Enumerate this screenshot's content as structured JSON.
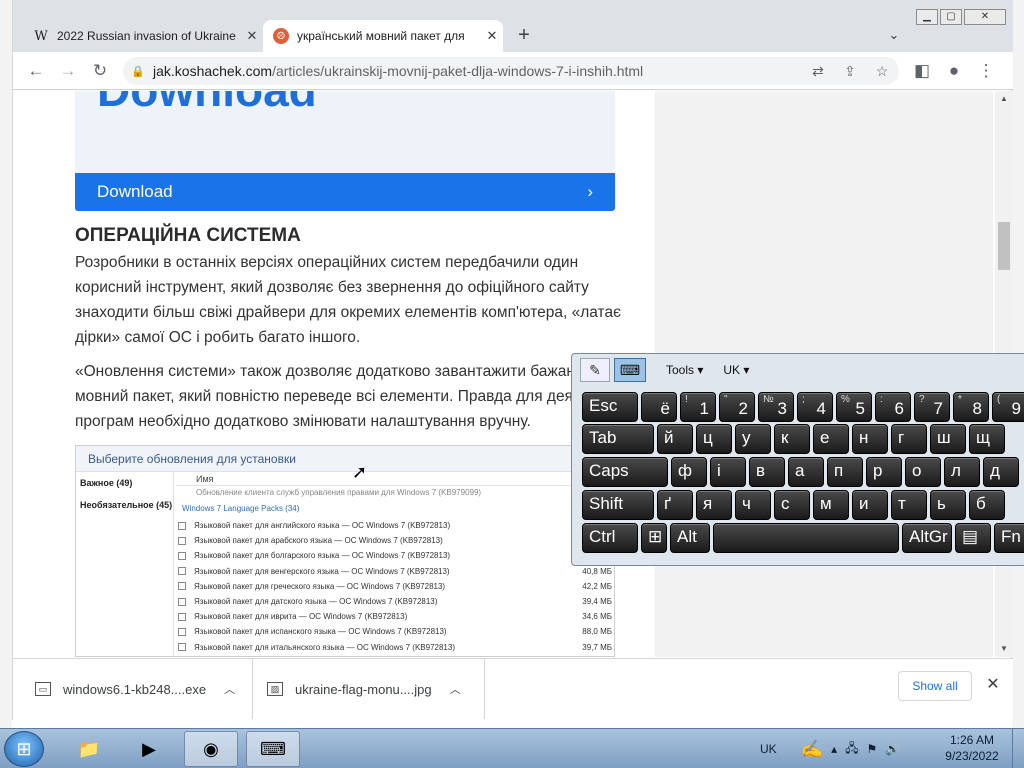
{
  "browser": {
    "tabs": [
      {
        "title": "2022 Russian invasion of Ukraine",
        "favicon": "W"
      },
      {
        "title": "український мовний пакет для",
        "favicon": "face-icon"
      }
    ],
    "new_tab": "+",
    "url_host": "jak.koshachek.com",
    "url_path": "/articles/ukrainskij-movnij-paket-dlja-windows-7-i-inshih.html"
  },
  "article": {
    "download_big": "Download",
    "download_button": "Download",
    "heading": "ОПЕРАЦІЙНА СИСТЕМА",
    "para1": "Розробники в останніх версіях операційних систем передбачили один корисний інструмент, який дозволяє без звернення до офіційного сайту знаходити більш свіжі драйвери для окремих елементів комп'ютера, «латає дірки» самої ОС і робить багато іншого.",
    "para2": "«Оновлення системи» також дозволяє додатково завантажити бажаний мовний пакет, який повністю переведе всі елементи. Правда для деяких програм необхідно додатково змінювати налаштування вручну.",
    "screenshot": {
      "header": "Выберите обновления для установки",
      "left": [
        "Важное (49)",
        "Необязательное (45)"
      ],
      "col_name": "Имя",
      "sub": "Обновление клиента служб управления правами для Windows 7 (KB979099)",
      "group": "Windows 7 Language Packs (34)",
      "rows": [
        {
          "name": "Языковой пакет для английского языка — ОС Windows 7 (KB972813)",
          "size": ""
        },
        {
          "name": "Языковой пакет для арабского языка — ОС Windows 7 (KB972813)",
          "size": ""
        },
        {
          "name": "Языковой пакет для болгарского языка — ОС Windows 7 (KB972813)",
          "size": ""
        },
        {
          "name": "Языковой пакет для венгерского языка — ОС Windows 7 (KB972813)",
          "size": "40,8 МБ"
        },
        {
          "name": "Языковой пакет для греческого языка — ОС Windows 7 (KB972813)",
          "size": "42,2 МБ"
        },
        {
          "name": "Языковой пакет для датского языка — ОС Windows 7 (KB972813)",
          "size": "39,4 МБ"
        },
        {
          "name": "Языковой пакет для иврита — ОС Windows 7 (KB972813)",
          "size": "34,6 МБ"
        },
        {
          "name": "Языковой пакет для испанского языка — ОС Windows 7 (KB972813)",
          "size": "88,0 МБ"
        },
        {
          "name": "Языковой пакет для итальянского языка — ОС Windows 7 (KB972813)",
          "size": "39,7 МБ"
        }
      ]
    }
  },
  "downloads": {
    "items": [
      "windows6.1-kb248....exe",
      "ukraine-flag-monu....jpg"
    ],
    "show_all": "Show all"
  },
  "osk": {
    "tools": "Tools",
    "lang": "UK",
    "row1": [
      {
        "main": "Esc"
      },
      {
        "top": "",
        "bottom": "ё"
      },
      {
        "top": "!",
        "bottom": "1"
      },
      {
        "top": "\"",
        "bottom": "2"
      },
      {
        "top": "№",
        "bottom": "3"
      },
      {
        "top": ";",
        "bottom": "4"
      },
      {
        "top": "%",
        "bottom": "5"
      },
      {
        "top": ":",
        "bottom": "6"
      },
      {
        "top": "?",
        "bottom": "7"
      },
      {
        "top": "*",
        "bottom": "8"
      },
      {
        "top": "(",
        "bottom": "9"
      }
    ],
    "row2": [
      "Tab",
      "й",
      "ц",
      "у",
      "к",
      "е",
      "н",
      "г",
      "ш",
      "щ"
    ],
    "row3": [
      "Caps",
      "ф",
      "і",
      "в",
      "а",
      "п",
      "р",
      "о",
      "л",
      "д"
    ],
    "row4": [
      "Shift",
      "ґ",
      "я",
      "ч",
      "с",
      "м",
      "и",
      "т",
      "ь",
      "б"
    ],
    "row5": [
      "Ctrl",
      "⊞",
      "Alt",
      "",
      "AltGr",
      "▤",
      "Fn"
    ]
  },
  "taskbar": {
    "lang": "UK",
    "time": "1:26 AM",
    "date": "9/23/2022"
  }
}
